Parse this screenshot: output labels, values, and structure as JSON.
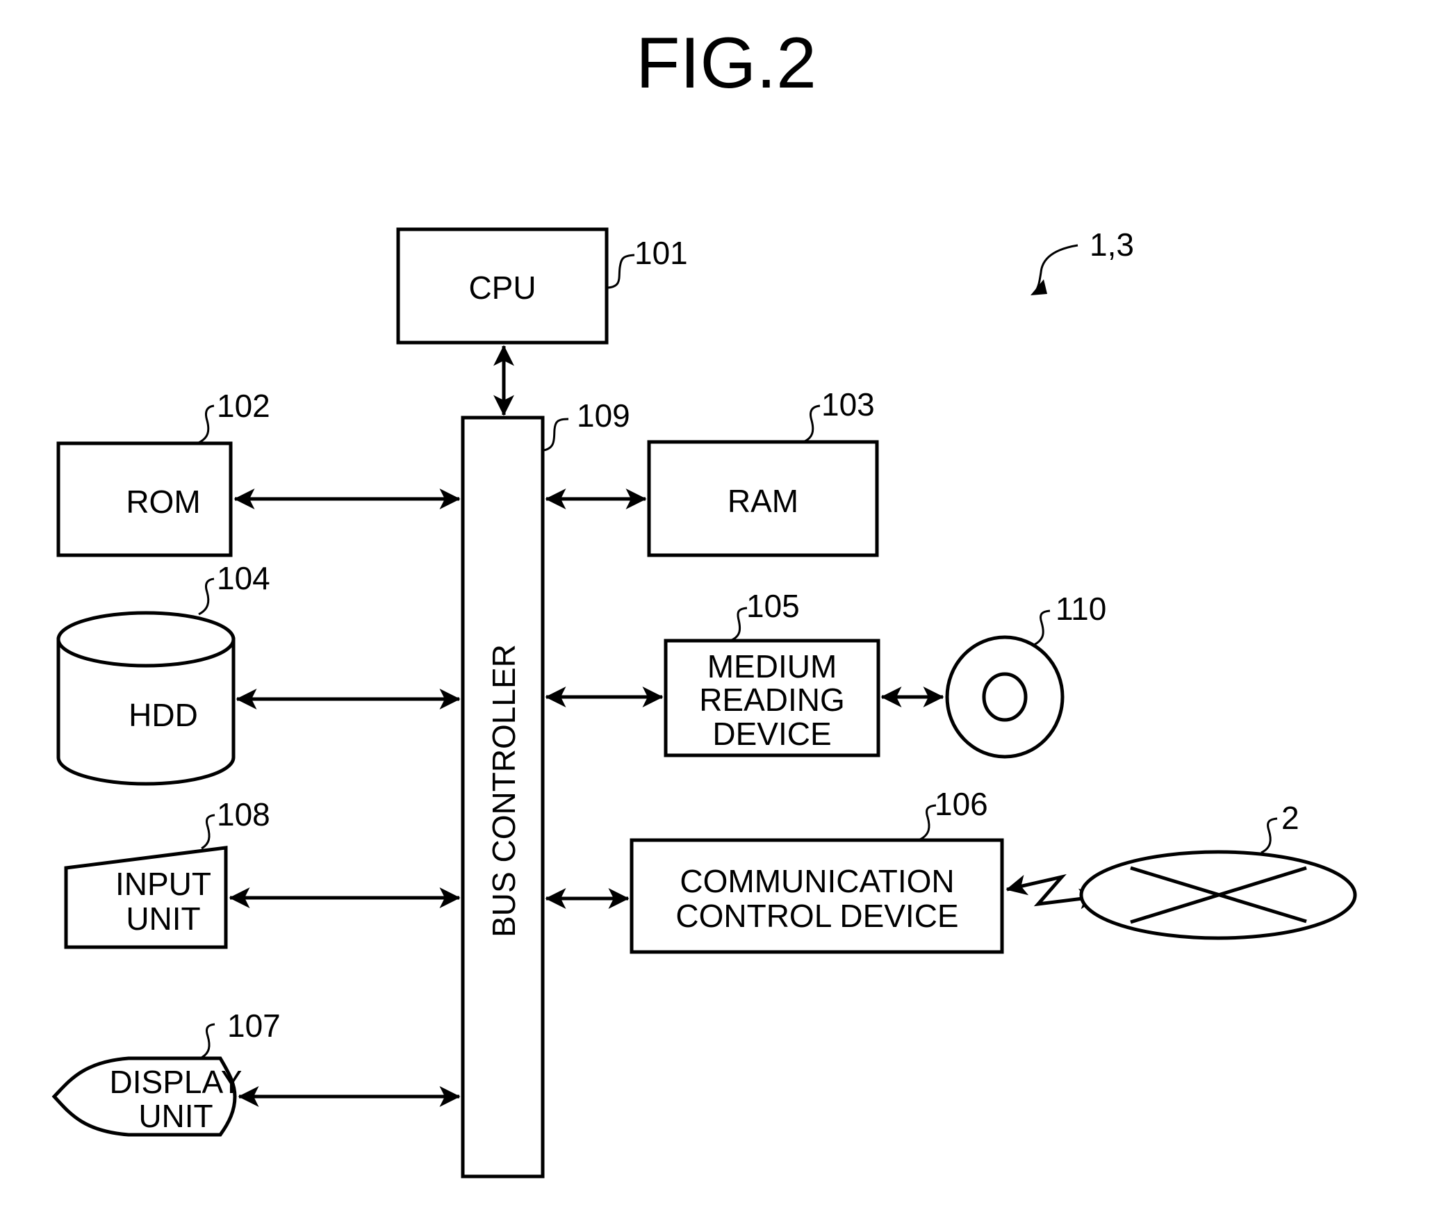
{
  "figure": {
    "title": "FIG.2",
    "system_ref": "1,3"
  },
  "components": {
    "cpu": {
      "label": "CPU",
      "ref": "101"
    },
    "rom": {
      "label": "ROM",
      "ref": "102"
    },
    "ram": {
      "label": "RAM",
      "ref": "103"
    },
    "hdd": {
      "label": "HDD",
      "ref": "104"
    },
    "medium_reading_device": {
      "lines": [
        "MEDIUM",
        "READING",
        "DEVICE"
      ],
      "ref": "105"
    },
    "communication_control_device": {
      "lines": [
        "COMMUNICATION",
        "CONTROL DEVICE"
      ],
      "ref": "106"
    },
    "display_unit": {
      "lines": [
        "DISPLAY",
        "UNIT"
      ],
      "ref": "107"
    },
    "input_unit": {
      "lines": [
        "INPUT",
        "UNIT"
      ],
      "ref": "108"
    },
    "bus_controller": {
      "label": "BUS CONTROLLER",
      "ref": "109"
    },
    "storage_medium": {
      "ref": "110"
    },
    "network": {
      "ref": "2"
    }
  },
  "connections": [
    {
      "from": "cpu",
      "to": "bus_controller",
      "type": "bidirectional"
    },
    {
      "from": "rom",
      "to": "bus_controller",
      "type": "bidirectional"
    },
    {
      "from": "ram",
      "to": "bus_controller",
      "type": "bidirectional"
    },
    {
      "from": "hdd",
      "to": "bus_controller",
      "type": "bidirectional"
    },
    {
      "from": "medium_reading_device",
      "to": "bus_controller",
      "type": "bidirectional"
    },
    {
      "from": "medium_reading_device",
      "to": "storage_medium",
      "type": "bidirectional"
    },
    {
      "from": "communication_control_device",
      "to": "bus_controller",
      "type": "bidirectional"
    },
    {
      "from": "communication_control_device",
      "to": "network",
      "type": "wireless-bidirectional"
    },
    {
      "from": "input_unit",
      "to": "bus_controller",
      "type": "bidirectional"
    },
    {
      "from": "display_unit",
      "to": "bus_controller",
      "type": "bidirectional"
    }
  ]
}
